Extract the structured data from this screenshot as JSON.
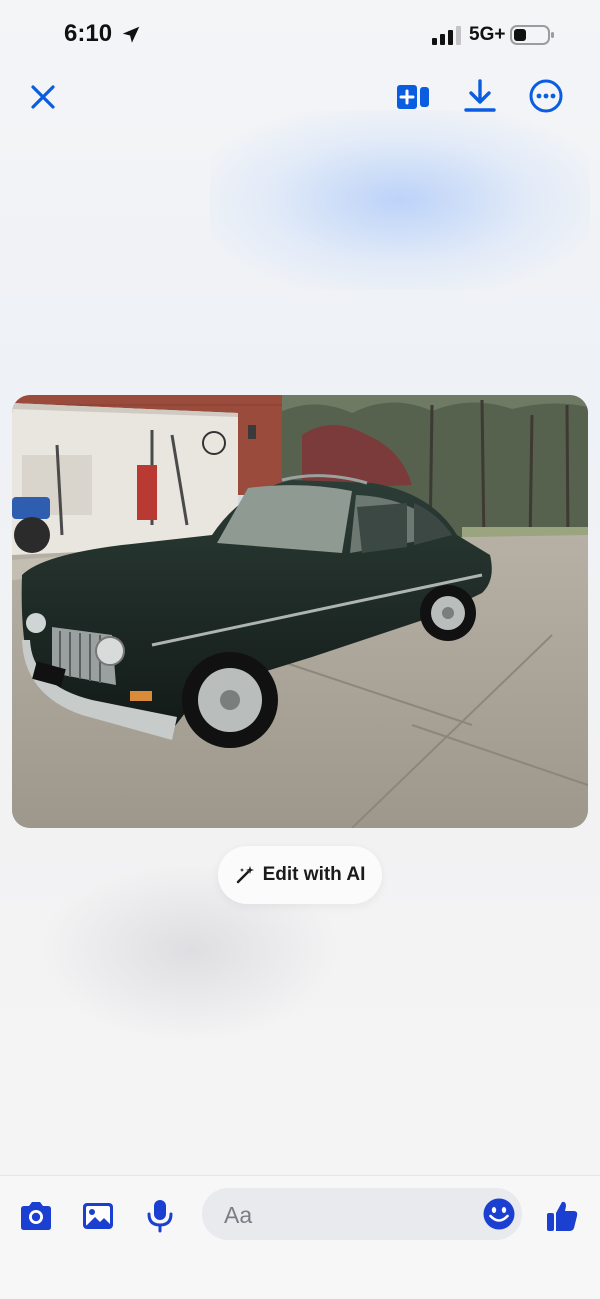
{
  "status_bar": {
    "time": "6:10",
    "network": "5G+",
    "location_icon": "location-arrow-icon",
    "signal_icon": "cellular-signal-icon",
    "battery_icon": "battery-icon"
  },
  "toolbar": {
    "close_icon": "close-icon",
    "compare_icon": "add-to-collection-icon",
    "download_icon": "download-icon",
    "more_icon": "more-options-icon"
  },
  "photo": {
    "subject": "photo-image"
  },
  "edit_ai": {
    "label": "Edit with AI",
    "icon": "magic-wand-icon"
  },
  "composer": {
    "placeholder": "Aa",
    "camera_icon": "camera-icon",
    "gallery_icon": "gallery-icon",
    "mic_icon": "microphone-icon",
    "emoji_icon": "emoji-icon",
    "like_icon": "thumbs-up-icon"
  },
  "colors": {
    "accent": "#0a5ce0",
    "accent_dark": "#1a3fd1",
    "background": "#f2f3f5"
  }
}
